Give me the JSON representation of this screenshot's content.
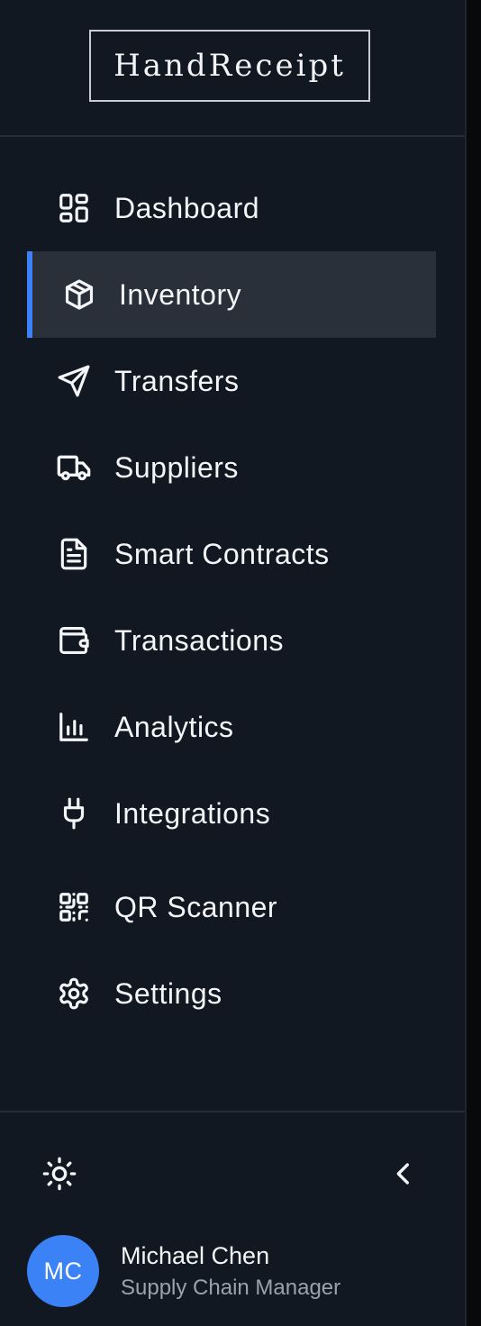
{
  "app": {
    "logo_text": "HandReceipt"
  },
  "nav": {
    "items": [
      {
        "label": "Dashboard",
        "icon": "dashboard-icon",
        "active": false
      },
      {
        "label": "Inventory",
        "icon": "package-icon",
        "active": true
      },
      {
        "label": "Transfers",
        "icon": "send-icon",
        "active": false
      },
      {
        "label": "Suppliers",
        "icon": "truck-icon",
        "active": false
      },
      {
        "label": "Smart Contracts",
        "icon": "document-icon",
        "active": false
      },
      {
        "label": "Transactions",
        "icon": "wallet-icon",
        "active": false
      },
      {
        "label": "Analytics",
        "icon": "bar-chart-icon",
        "active": false
      },
      {
        "label": "Integrations",
        "icon": "plug-icon",
        "active": false
      },
      {
        "label": "QR Scanner",
        "icon": "qr-code-icon",
        "active": false
      },
      {
        "label": "Settings",
        "icon": "gear-icon",
        "active": false
      }
    ]
  },
  "footer": {
    "theme_icon": "sun-icon",
    "collapse_icon": "chevron-left-icon"
  },
  "user": {
    "initials": "MC",
    "name": "Michael Chen",
    "role": "Supply Chain Manager"
  },
  "colors": {
    "accent": "#3b82f6",
    "sidebar_bg": "#121821",
    "active_bg": "#2a303a"
  }
}
